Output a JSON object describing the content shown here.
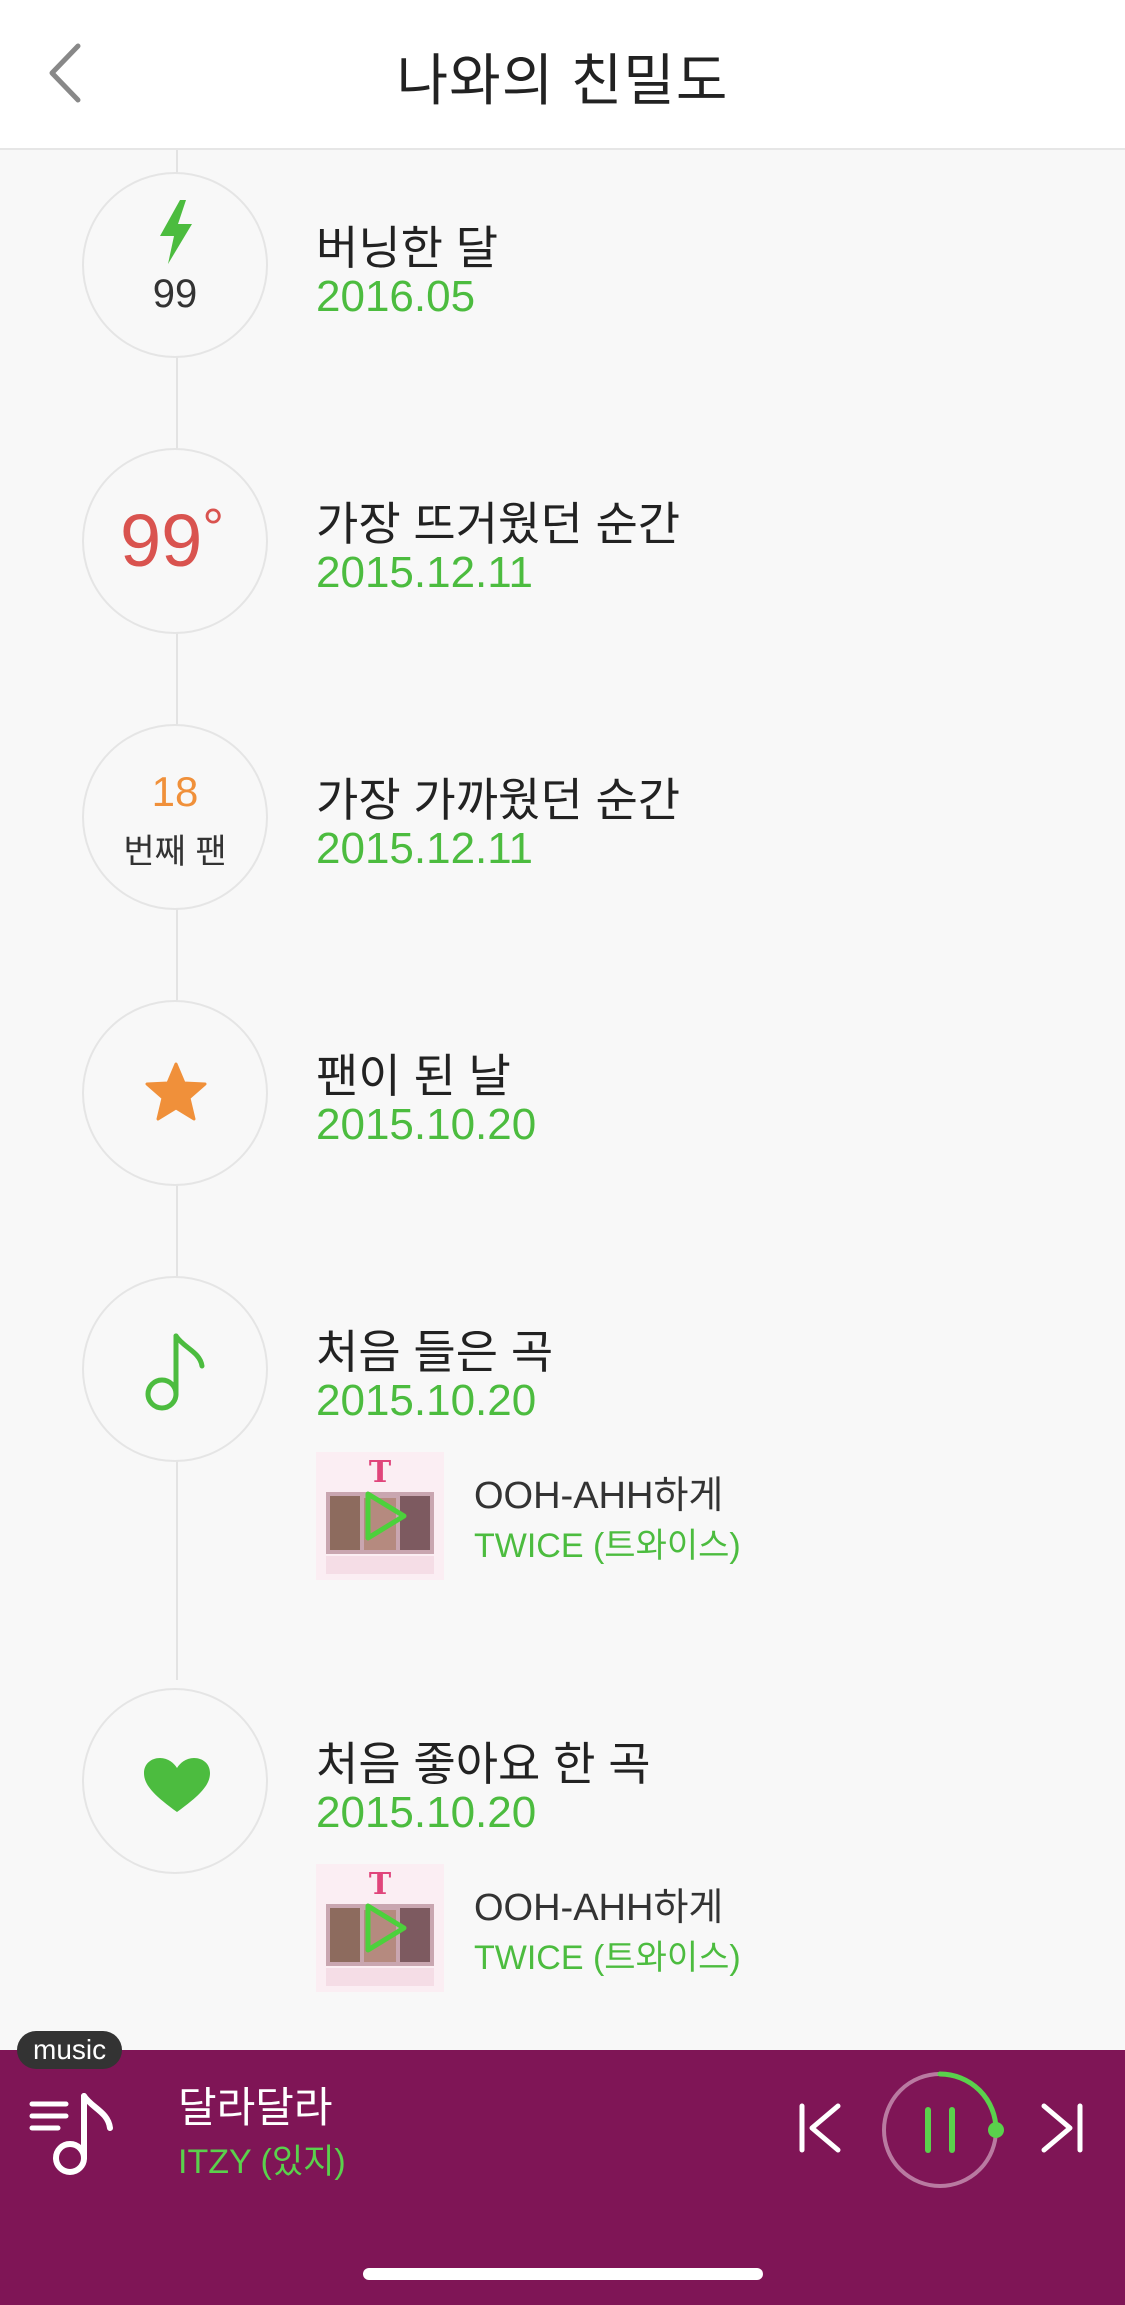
{
  "header": {
    "title": "나와의 친밀도"
  },
  "timeline": [
    {
      "key": "burning",
      "title": "버닝한 달",
      "date": "2016.05",
      "icon": "lightning-icon",
      "value": "99"
    },
    {
      "key": "hottest",
      "title": "가장 뜨거웠던 순간",
      "date": "2015.12.11",
      "value": "99",
      "unit": "°"
    },
    {
      "key": "closest",
      "title": "가장 가까웠던 순간",
      "date": "2015.12.11",
      "value": "18",
      "caption": "번째 팬"
    },
    {
      "key": "fan_day",
      "title": "팬이 된 날",
      "date": "2015.10.20",
      "icon": "star-icon"
    },
    {
      "key": "first_listened",
      "title": "처음 들은 곡",
      "date": "2015.10.20",
      "icon": "music-note-icon",
      "song": {
        "title": "OOH-AHH하게",
        "artist": "TWICE (트와이스)"
      }
    },
    {
      "key": "first_liked",
      "title": "처음 좋아요 한 곡",
      "date": "2015.10.20",
      "icon": "heart-icon",
      "song": {
        "title": "OOH-AHH하게",
        "artist": "TWICE (트와이스)"
      }
    }
  ],
  "player": {
    "badge": "music",
    "song": "달라달라",
    "artist": "ITZY (있지)",
    "progress": 0.25
  },
  "colors": {
    "accent_green": "#4cbc3f",
    "hot_red": "#d9534f",
    "orange": "#f0903a",
    "player_bg": "#7f1556"
  }
}
